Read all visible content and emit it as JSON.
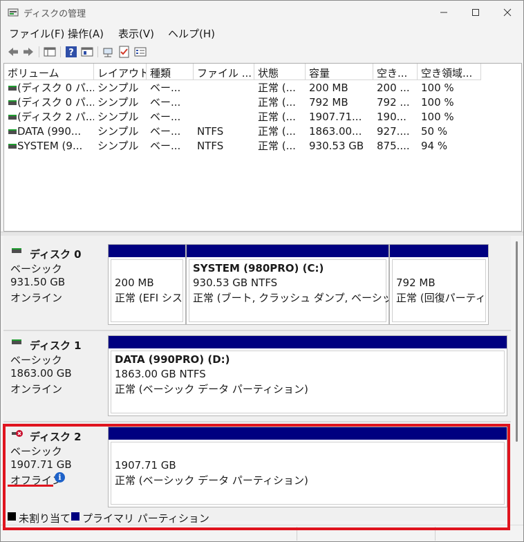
{
  "window": {
    "title": "ディスクの管理"
  },
  "menu": [
    "ファイル(F)",
    "操作(A)",
    "表示(V)",
    "ヘルプ(H)"
  ],
  "toolbar": {
    "icons": [
      "back-arrow-icon",
      "forward-arrow-icon",
      "disk-list-icon",
      "help-icon",
      "properties-icon",
      "connect-icon",
      "check-icon",
      "settings-list-icon"
    ]
  },
  "volume_list": {
    "columns": [
      "ボリューム",
      "レイアウト",
      "種類",
      "ファイル ...",
      "状態",
      "容量",
      "空き...",
      "空き領域..."
    ],
    "rows": [
      [
        "(ディスク 0 パ...",
        "シンプル",
        "ベー...",
        "",
        "正常 (...",
        "200 MB",
        "200 ...",
        "100 %"
      ],
      [
        "(ディスク 0 パ...",
        "シンプル",
        "ベー...",
        "",
        "正常 (...",
        "792 MB",
        "792 ...",
        "100 %"
      ],
      [
        "(ディスク 2 パ...",
        "シンプル",
        "ベー...",
        "",
        "正常 (...",
        "1907.71...",
        "190...",
        "100 %"
      ],
      [
        "DATA (990...",
        "シンプル",
        "ベー...",
        "NTFS",
        "正常 (...",
        "1863.00...",
        "927....",
        "50 %"
      ],
      [
        "SYSTEM (9...",
        "シンプル",
        "ベー...",
        "NTFS",
        "正常 (...",
        "930.53 GB",
        "875....",
        "94 %"
      ]
    ]
  },
  "disks": [
    {
      "name": "ディスク 0",
      "type": "ベーシック",
      "size": "931.50 GB",
      "status": "オンライン",
      "partitions": [
        {
          "title": "",
          "size": "200 MB",
          "status": "正常 (EFI シス"
        },
        {
          "title": "SYSTEM (980PRO)  (C:)",
          "size": "930.53 GB NTFS",
          "status": "正常 (ブート, クラッシュ ダンプ, ベーシック デ"
        },
        {
          "title": "",
          "size": "792 MB",
          "status": "正常 (回復パーティ"
        }
      ]
    },
    {
      "name": "ディスク 1",
      "type": "ベーシック",
      "size": "1863.00 GB",
      "status": "オンライン",
      "partitions": [
        {
          "title": "DATA (990PRO)  (D:)",
          "size": "1863.00 GB NTFS",
          "status": "正常 (ベーシック データ パーティション)"
        }
      ]
    },
    {
      "name": "ディスク 2",
      "type": "ベーシック",
      "size": "1907.71 GB",
      "status": "オフライン",
      "partitions": [
        {
          "title": "",
          "size": "1907.71 GB",
          "status": "正常 (ベーシック データ パーティション)"
        }
      ]
    }
  ],
  "legend": [
    {
      "label": "未割り当て",
      "color": "#000000"
    },
    {
      "label": "プライマリ パーティション",
      "color": "#000080"
    }
  ],
  "colors": {
    "partition_bar": "#000080",
    "highlight": "#e0141e",
    "info": "#1e62c9"
  }
}
